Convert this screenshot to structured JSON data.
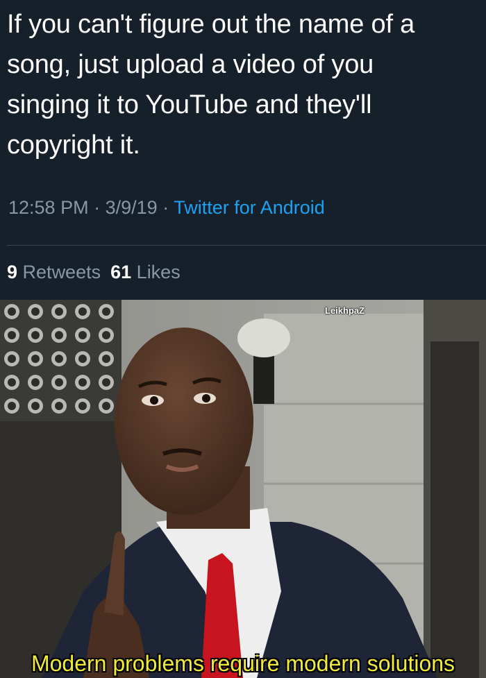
{
  "tweet": {
    "text_lines": [
      "If you can't figure out the name of a",
      "song, just upload a video of you",
      "singing it to YouTube and they'll",
      "copyright it."
    ],
    "time": "12:58 PM",
    "date": "3/9/19",
    "separator": "·",
    "source": "Twitter for Android",
    "retweets_count": "9",
    "retweets_label": "Retweets",
    "likes_count": "61",
    "likes_label": "Likes"
  },
  "meme": {
    "watermark": "LeikhpaZ",
    "caption": "Modern problems require modern solutions"
  },
  "colors": {
    "background": "#15202b",
    "link": "#1da1f2",
    "muted": "#8899a6",
    "caption": "#f2ea3a"
  }
}
